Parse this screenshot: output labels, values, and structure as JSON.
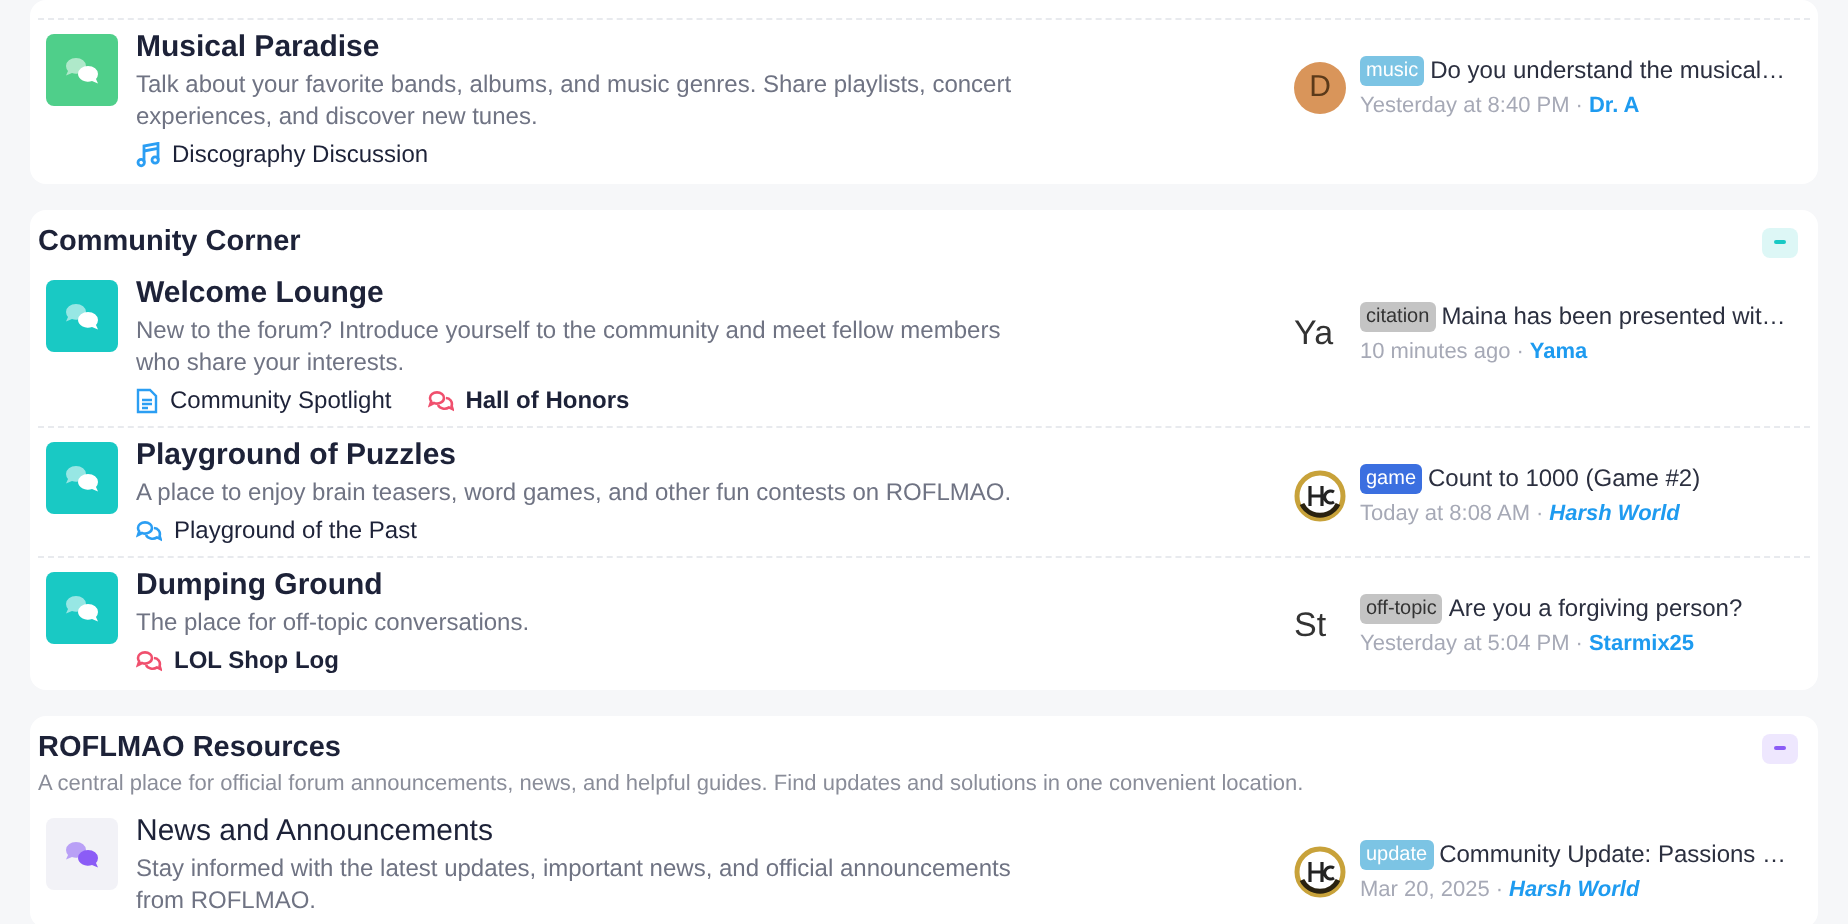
{
  "sections": [
    {
      "forums": [
        {
          "title": "Musical Paradise",
          "unread": true,
          "color": "#4fcf8a",
          "description": "Talk about your favorite bands, albums, and music genres. Share playlists, concert experiences, and discover new tunes.",
          "subforums": [
            {
              "kind": "music",
              "label": "Discography Discussion",
              "unread": false
            }
          ],
          "last_post": {
            "avatar": {
              "kind": "letter",
              "text": "D",
              "color": "#d9955a"
            },
            "tag": {
              "label": "music",
              "color": "#7cc4e4"
            },
            "title": "Do you understand the musical…",
            "time": "Yesterday at 8:40 PM",
            "separator": "·",
            "author": {
              "name": "Dr. A",
              "styled": false
            }
          }
        }
      ]
    },
    {
      "title": "Community Corner",
      "toggle": {
        "expanded": true,
        "color": "#19c9c4"
      },
      "forums": [
        {
          "title": "Welcome Lounge",
          "unread": true,
          "color": "#19c9c4",
          "description": "New to the forum? Introduce yourself to the community and meet fellow members who share your interests.",
          "subforums": [
            {
              "kind": "document",
              "label": "Community Spotlight",
              "unread": false
            },
            {
              "kind": "chat",
              "label": "Hall of Honors",
              "unread": true
            }
          ],
          "last_post": {
            "avatar": {
              "kind": "alt",
              "text": "Ya"
            },
            "tag": {
              "label": "citation",
              "color": "#c4c4c4"
            },
            "title": "Maina has been presented wit…",
            "time": "10 minutes ago",
            "separator": "·",
            "author": {
              "name": "Yama",
              "styled": false
            }
          }
        },
        {
          "title": "Playground of Puzzles",
          "unread": true,
          "color": "#19c9c4",
          "description": "A place to enjoy brain teasers, word games, and other fun contests on ROFLMAO.",
          "subforums": [
            {
              "kind": "chat",
              "label": "Playground of the Past",
              "unread": false
            }
          ],
          "last_post": {
            "avatar": {
              "kind": "ring"
            },
            "tag": {
              "label": "game",
              "color": "#3b6fe0"
            },
            "title": "Count to 1000 (Game #2)",
            "time": "Today at 8:08 AM",
            "separator": "·",
            "author": {
              "name": "Harsh World",
              "styled": true
            }
          }
        },
        {
          "title": "Dumping Ground",
          "unread": true,
          "color": "#19c9c4",
          "description": "The place for off-topic conversations.",
          "subforums": [
            {
              "kind": "chat",
              "label": "LOL Shop Log",
              "unread": true
            }
          ],
          "last_post": {
            "avatar": {
              "kind": "alt",
              "text": "St"
            },
            "tag": {
              "label": "off-topic",
              "color": "#c4c4c4"
            },
            "title": "Are you a forgiving person?",
            "time": "Yesterday at 5:04 PM",
            "separator": "·",
            "author": {
              "name": "Starmix25",
              "styled": false
            }
          }
        }
      ]
    },
    {
      "title": "ROFLMAO Resources",
      "description": "A central place for official forum announcements, news, and helpful guides. Find updates and solutions in one convenient location.",
      "toggle": {
        "expanded": true,
        "color": "#8b5cf6"
      },
      "forums": [
        {
          "title": "News and Announcements",
          "unread": false,
          "color": "#8b5cf6",
          "description": "Stay informed with the latest updates, important news, and official announcements from ROFLMAO.",
          "last_post": {
            "avatar": {
              "kind": "ring"
            },
            "tag": {
              "label": "update",
              "color": "#7cc4e4"
            },
            "title": "Community Update: Passions …",
            "time": "Mar 20, 2025",
            "separator": "·",
            "author": {
              "name": "Harsh World",
              "styled": true
            }
          }
        }
      ]
    }
  ]
}
